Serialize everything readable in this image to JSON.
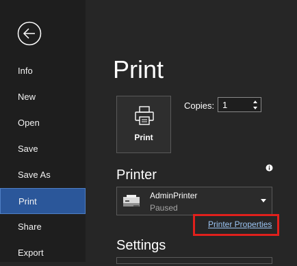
{
  "sidebar": {
    "back_label": "",
    "items": [
      {
        "label": "Info"
      },
      {
        "label": "New"
      },
      {
        "label": "Open"
      },
      {
        "label": "Save"
      },
      {
        "label": "Save As"
      },
      {
        "label": "Print",
        "active": true
      },
      {
        "label": "Share"
      },
      {
        "label": "Export"
      }
    ]
  },
  "main": {
    "title": "Print",
    "print_button_label": "Print",
    "copies_label": "Copies:",
    "copies_value": "1",
    "printer_heading": "Printer",
    "printer": {
      "name": "AdminPrinter",
      "status": "Paused"
    },
    "printer_properties_label": "Printer Properties",
    "settings_heading": "Settings"
  },
  "colors": {
    "sidebar_bg": "#1e1e1e",
    "main_bg": "#262626",
    "active_item": "#2b579a",
    "link": "#9cc6f5",
    "highlight": "#e0201c"
  },
  "icons": {
    "back": "arrow-left-circle-icon",
    "print": "printer-icon",
    "info": "info-icon",
    "printer_device": "printer-device-icon",
    "dropdown": "chevron-down-icon"
  }
}
